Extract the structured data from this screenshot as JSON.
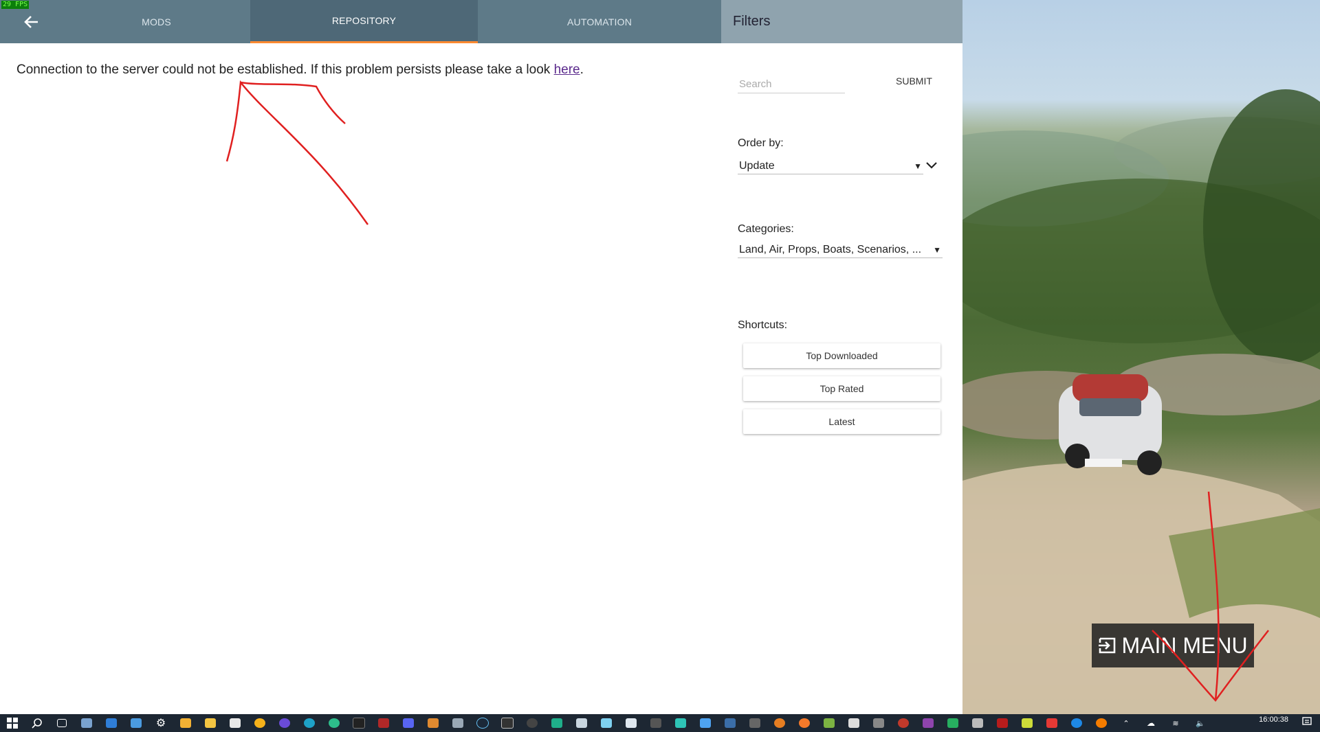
{
  "fps": "29 FPS",
  "tabs": [
    {
      "label": "MODS",
      "active": false
    },
    {
      "label": "REPOSITORY",
      "active": true
    },
    {
      "label": "AUTOMATION",
      "active": false
    }
  ],
  "accent_color": "#ff8a30",
  "filters": {
    "title": "Filters",
    "search_placeholder": "Search",
    "submit_label": "SUBMIT",
    "order_label": "Order by:",
    "order_value": "Update",
    "categories_label": "Categories:",
    "categories_value": "Land, Air, Props, Boats, Scenarios, ...",
    "shortcuts_label": "Shortcuts:",
    "shortcuts": [
      "Top Downloaded",
      "Top Rated",
      "Latest"
    ]
  },
  "main": {
    "message": "Connection to the server could not be established. If this problem persists please take a look ",
    "link_text": "here",
    "message_end": "."
  },
  "game": {
    "main_menu_label": "MAIN MENU",
    "icon": "exit-door-icon"
  },
  "taskbar": {
    "clock": "16:00:38"
  }
}
